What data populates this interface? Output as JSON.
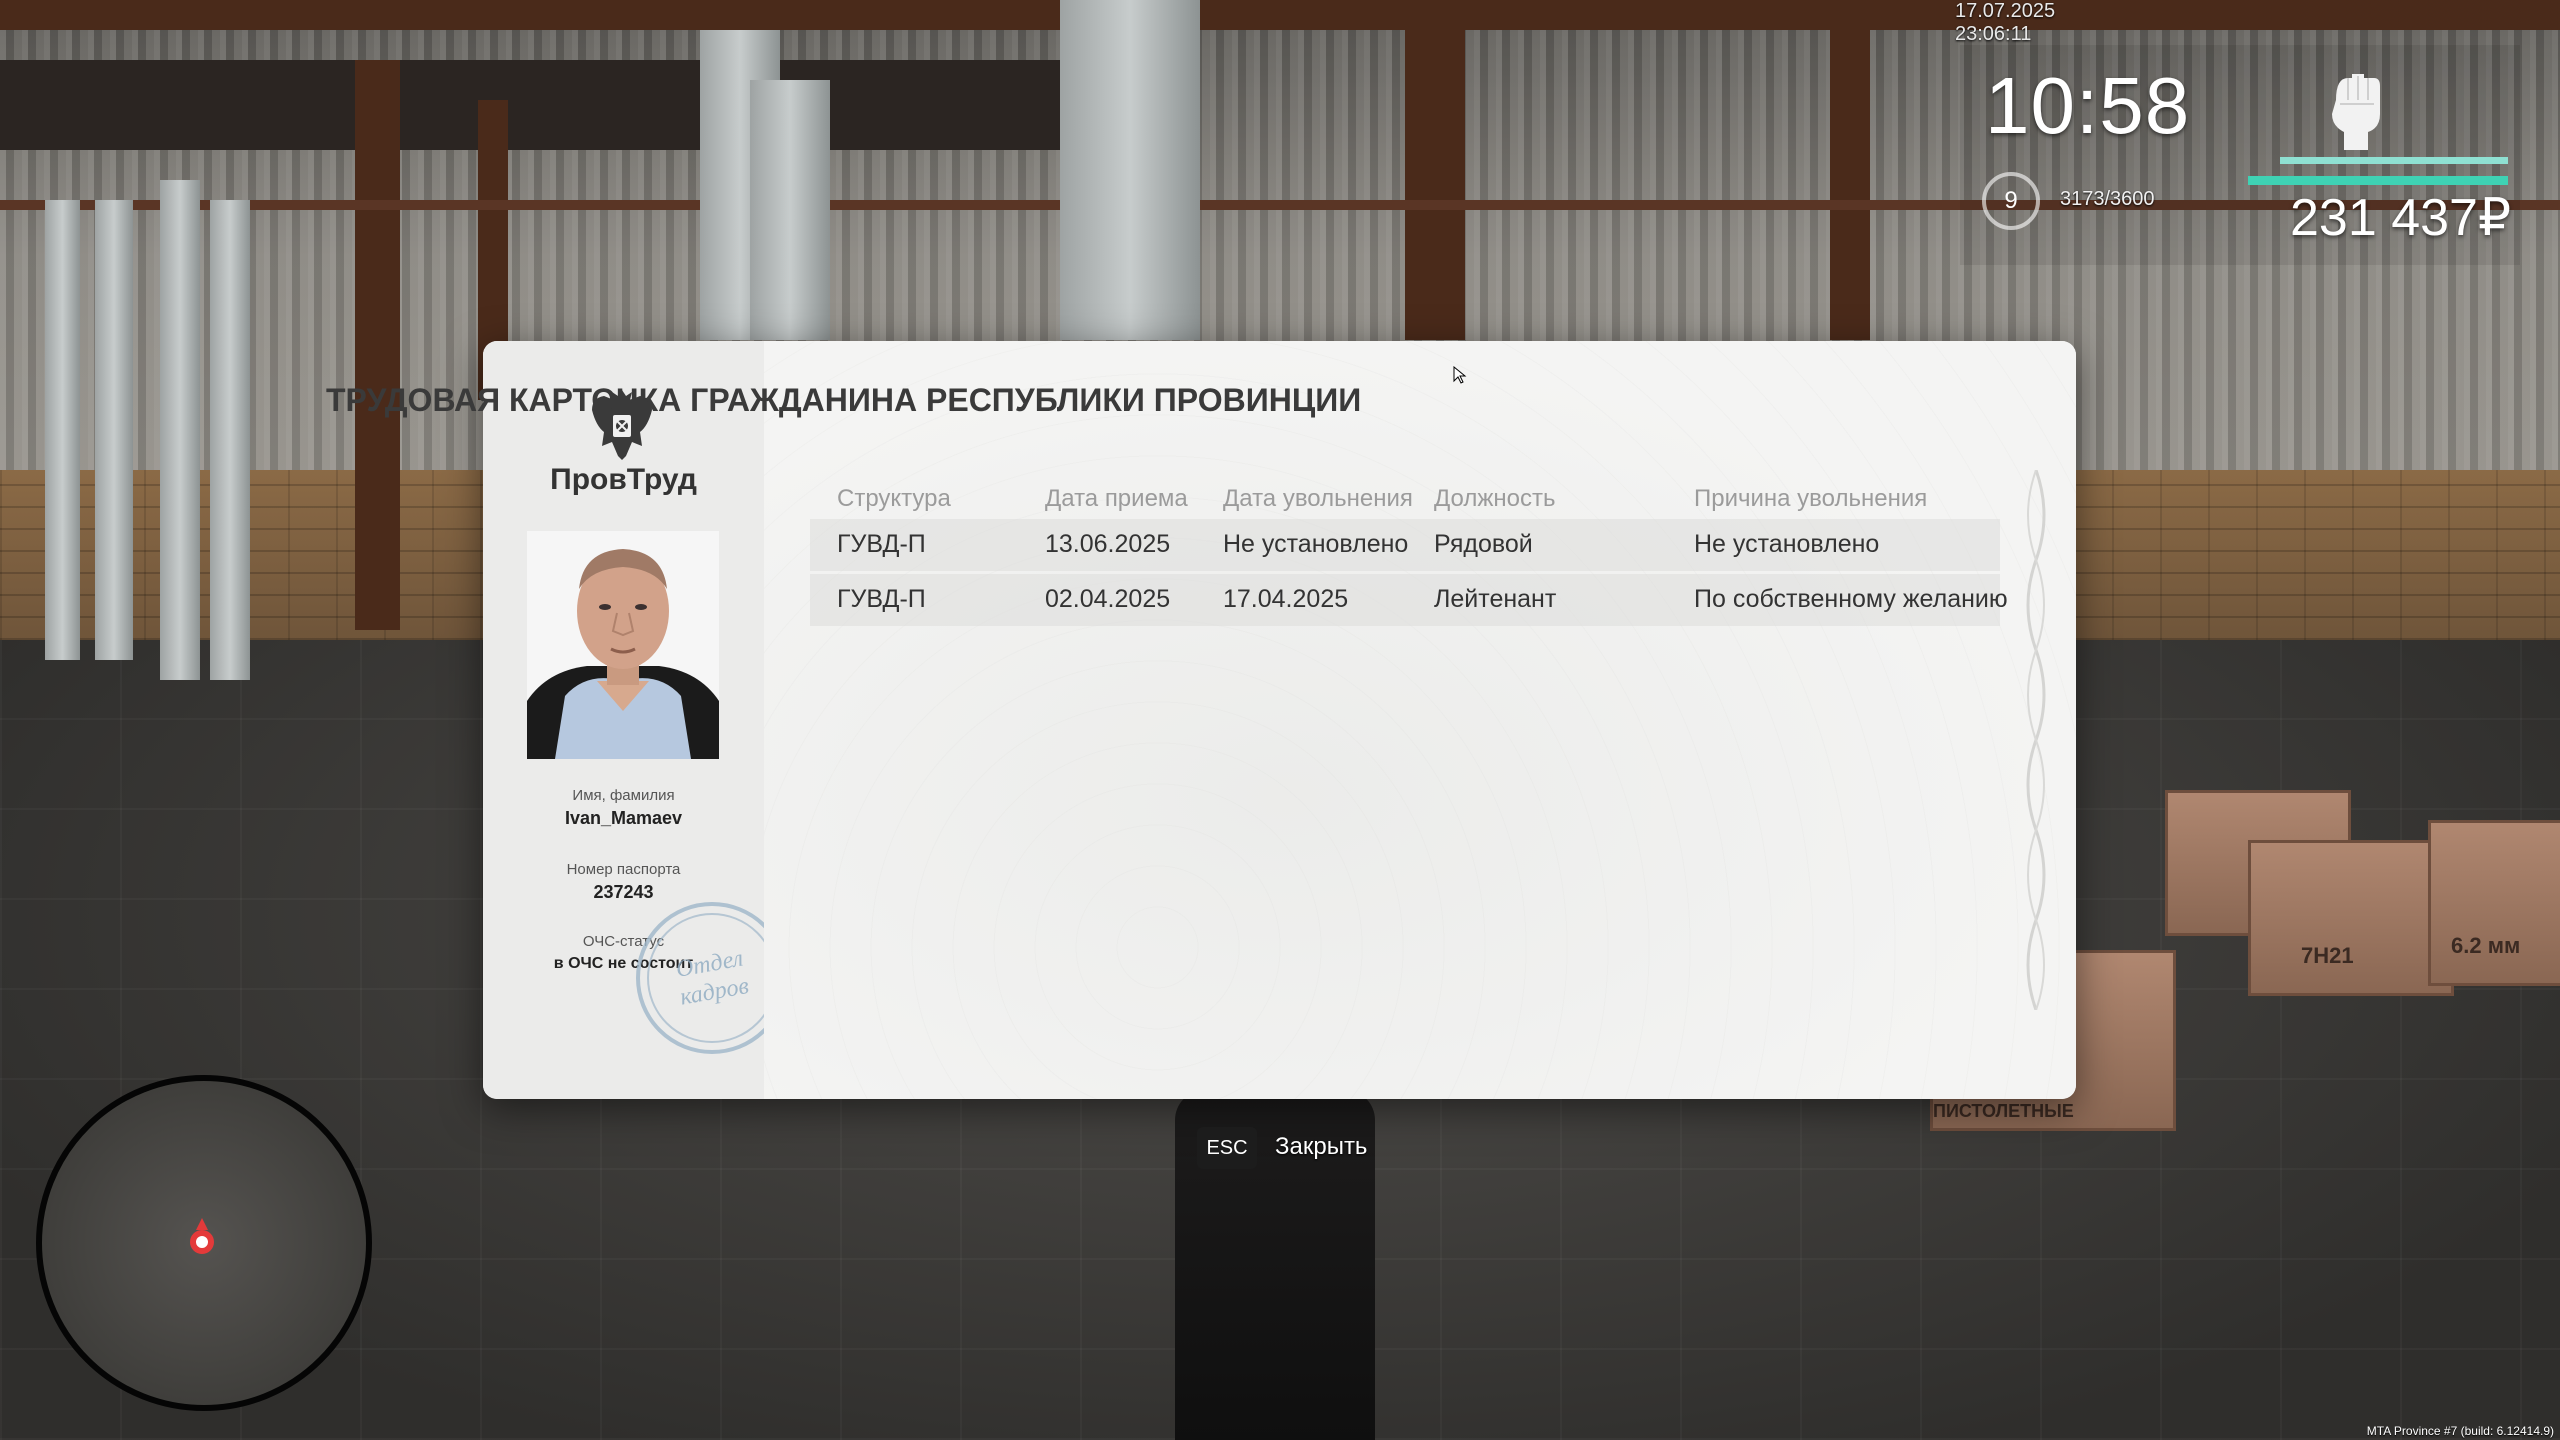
{
  "hud": {
    "datetime": "17.07.2025 23:06:11",
    "time": "10:58",
    "level": "9",
    "experience": "3173/3600",
    "money": "231 437₽",
    "health_level": 1.0,
    "armor_level": 1.0,
    "icons": [
      "fist-icon",
      "level-ring-icon",
      "minimap-marker-icon"
    ]
  },
  "card": {
    "title": "ТРУДОВАЯ КАРТОЧКА ГРАЖДАНИНА РЕСПУБЛИКИ ПРОВИНЦИИ",
    "org_name": "ПровТруд",
    "emblem": "coat-of-arms-icon",
    "name_label": "Имя, фамилия",
    "name_value": "Ivan_Mamaev",
    "passport_label": "Номер паспорта",
    "passport_value": "237243",
    "status_label": "ОЧС-статус",
    "status_value": "в ОЧС не состоит",
    "stamp_text": "Отдел кадров",
    "table": {
      "headers": [
        "Структура",
        "Дата приема",
        "Дата увольнения",
        "Должность",
        "Причина увольнения"
      ],
      "rows": [
        [
          "ГУВД-П",
          "13.06.2025",
          "Не установлено",
          "Рядовой",
          "Не установлено"
        ],
        [
          "ГУВД-П",
          "02.04.2025",
          "17.04.2025",
          "Лейтенант",
          "По собственному желанию"
        ]
      ]
    }
  },
  "close_hint": {
    "key": "ESC",
    "label": "Закрыть"
  },
  "scene": {
    "crate_labels": [
      "7Н21",
      "6.2 мм",
      "ПИСТОЛЕТНЫЕ"
    ]
  },
  "build_info": "MTA Province #7 (build: 6.12414.9)",
  "colors": {
    "health_bar": "#8fe0d2",
    "armor_bar": "#3fd2b4",
    "map_marker": "#e43a3a"
  }
}
